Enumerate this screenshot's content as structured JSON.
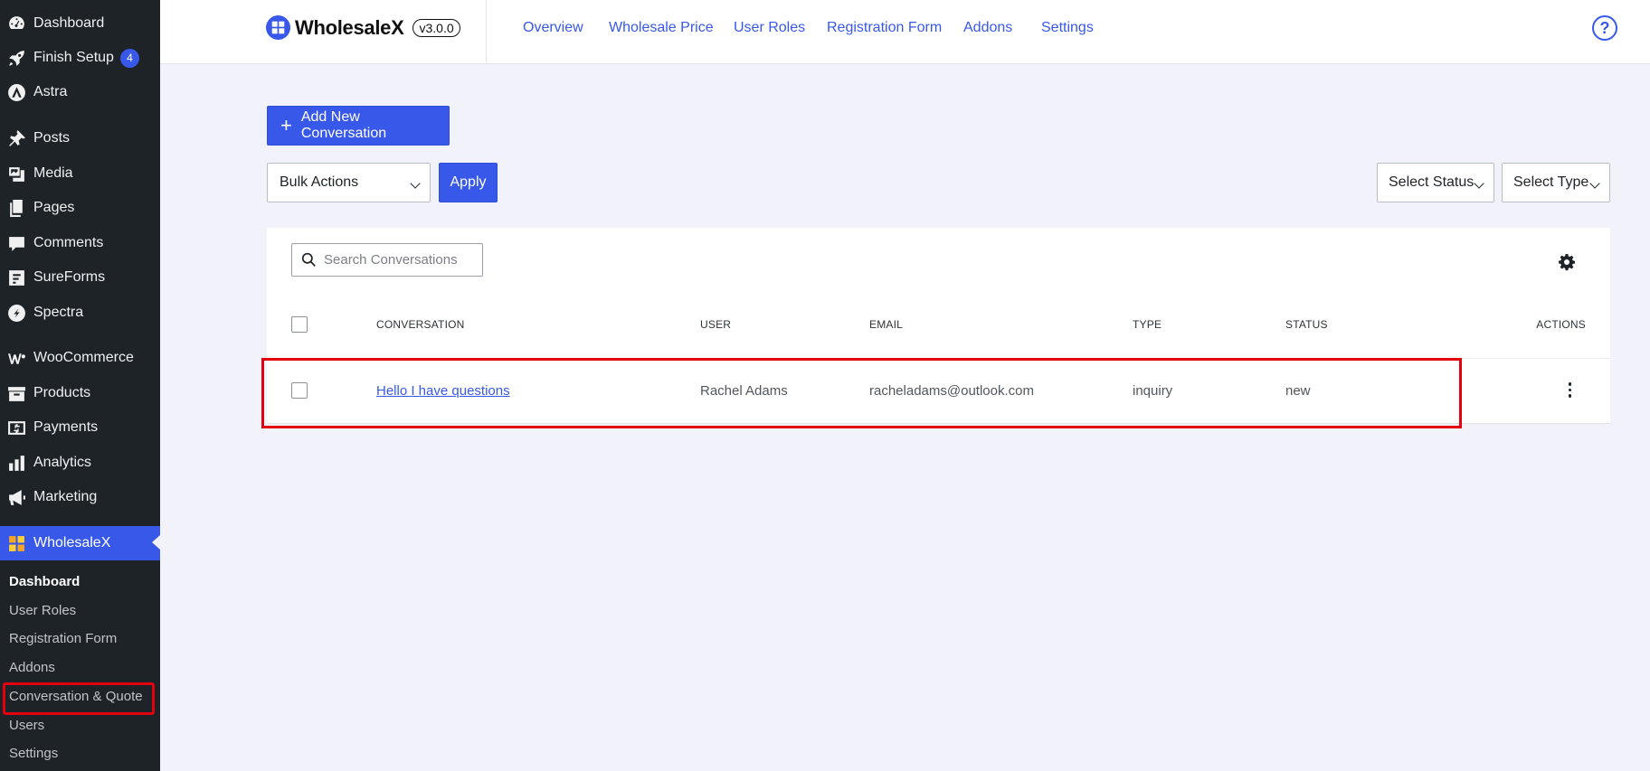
{
  "sidebar": {
    "items": [
      {
        "label": "Dashboard",
        "icon": "dashboard-icon"
      },
      {
        "label": "Finish Setup",
        "icon": "rocket-icon",
        "badge": "4"
      },
      {
        "label": "Astra",
        "icon": "astra-icon"
      },
      {
        "label": "Posts",
        "icon": "pin-icon"
      },
      {
        "label": "Media",
        "icon": "media-icon"
      },
      {
        "label": "Pages",
        "icon": "pages-icon"
      },
      {
        "label": "Comments",
        "icon": "comment-icon"
      },
      {
        "label": "SureForms",
        "icon": "sureforms-icon"
      },
      {
        "label": "Spectra",
        "icon": "spectra-icon"
      },
      {
        "label": "WooCommerce",
        "icon": "woocommerce-icon"
      },
      {
        "label": "Products",
        "icon": "archive-icon"
      },
      {
        "label": "Payments",
        "icon": "dollar-icon"
      },
      {
        "label": "Analytics",
        "icon": "bar-chart-icon"
      },
      {
        "label": "Marketing",
        "icon": "megaphone-icon"
      },
      {
        "label": "WholesaleX",
        "icon": "wholesalex-icon"
      }
    ],
    "submenu": [
      "Dashboard",
      "User Roles",
      "Registration Form",
      "Addons",
      "Conversation & Quote",
      "Users",
      "Settings"
    ]
  },
  "header": {
    "brand": "WholesaleX",
    "version": "v3.0.0",
    "nav": [
      "Overview",
      "Wholesale Price",
      "User Roles",
      "Registration Form",
      "Addons",
      "Settings"
    ],
    "help": "?"
  },
  "toolbar": {
    "add_label": "Add New Conversation",
    "bulk_actions": "Bulk Actions",
    "apply": "Apply",
    "select_status": "Select Status",
    "select_type": "Select Type"
  },
  "table": {
    "search_placeholder": "Search Conversations",
    "columns": [
      "CONVERSATION",
      "USER",
      "EMAIL",
      "TYPE",
      "STATUS",
      "ACTIONS"
    ],
    "rows": [
      {
        "conversation": "Hello I have questions",
        "user": "Rachel Adams",
        "email": "racheladams@outlook.com",
        "type": "inquiry",
        "status": "new"
      }
    ]
  },
  "colors": {
    "accent": "#3858e9",
    "sidebar": "#1d2327",
    "highlight": "#e3000f"
  }
}
